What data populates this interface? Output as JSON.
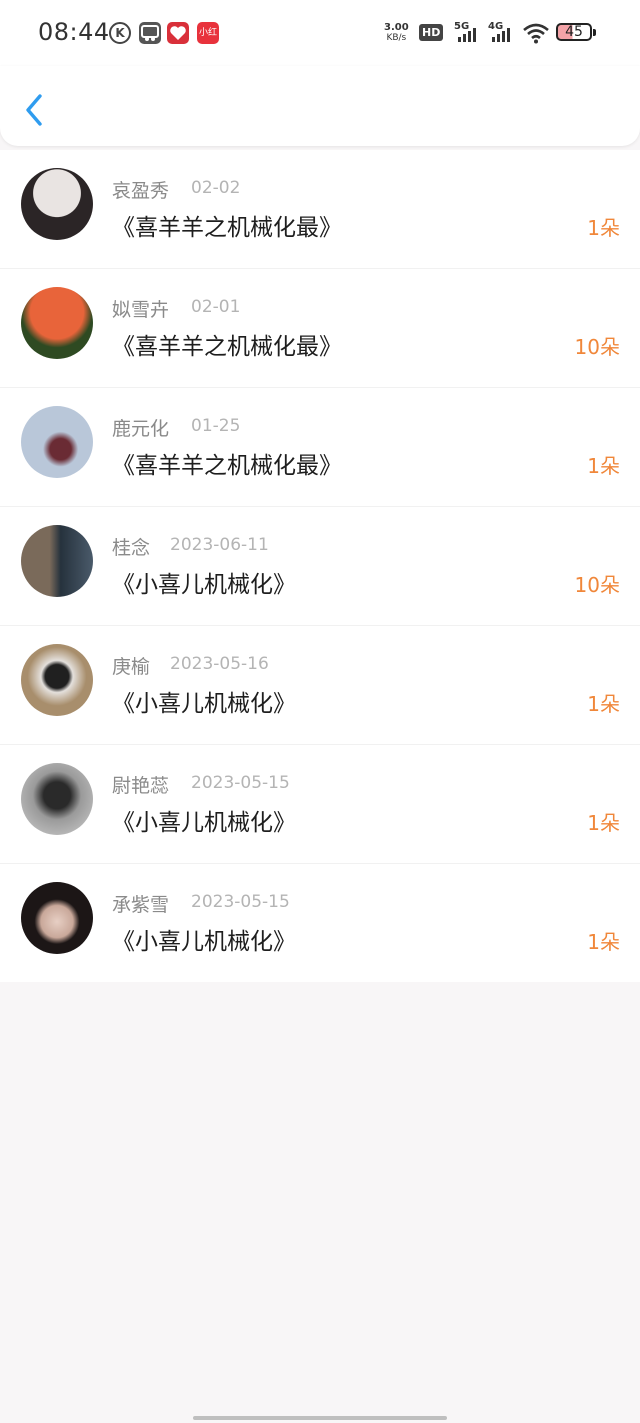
{
  "status_bar": {
    "time": "08:44",
    "net_speed_value": "3.00",
    "net_speed_unit": "KB/s",
    "hd_label": "HD",
    "sim1_label": "5G",
    "sim2_label": "4G",
    "battery_level": "45",
    "app_icons": [
      "K",
      "app-icon",
      "app-icon",
      "小红书"
    ]
  },
  "header": {
    "back_icon": "chevron-left-icon"
  },
  "items": [
    {
      "name": "哀盈秀",
      "date": "02-02",
      "title": "《喜羊羊之机械化最》",
      "count": "1朵",
      "avatar_colors": [
        "#e9e4e2",
        "#2b2526"
      ]
    },
    {
      "name": "姒雪卉",
      "date": "02-01",
      "title": "《喜羊羊之机械化最》",
      "count": "10朵",
      "avatar_colors": [
        "#e8643a",
        "#2e4a22"
      ]
    },
    {
      "name": "鹿元化",
      "date": "01-25",
      "title": "《喜羊羊之机械化最》",
      "count": "1朵",
      "avatar_colors": [
        "#b9c7d9",
        "#6a2b34"
      ]
    },
    {
      "name": "桂念",
      "date": "2023-06-11",
      "title": "《小喜儿机械化》",
      "count": "10朵",
      "avatar_colors": [
        "#7a6a5a",
        "#26323d"
      ]
    },
    {
      "name": "庚榆",
      "date": "2023-05-16",
      "title": "《小喜儿机械化》",
      "count": "1朵",
      "avatar_colors": [
        "#a88e6c",
        "#202020"
      ]
    },
    {
      "name": "尉艳蕊",
      "date": "2023-05-15",
      "title": "《小喜儿机械化》",
      "count": "1朵",
      "avatar_colors": [
        "#cfcfcf",
        "#2a2a2a"
      ]
    },
    {
      "name": "承紫雪",
      "date": "2023-05-15",
      "title": "《小喜儿机械化》",
      "count": "1朵",
      "avatar_colors": [
        "#c9a89a",
        "#1c1616"
      ]
    }
  ]
}
